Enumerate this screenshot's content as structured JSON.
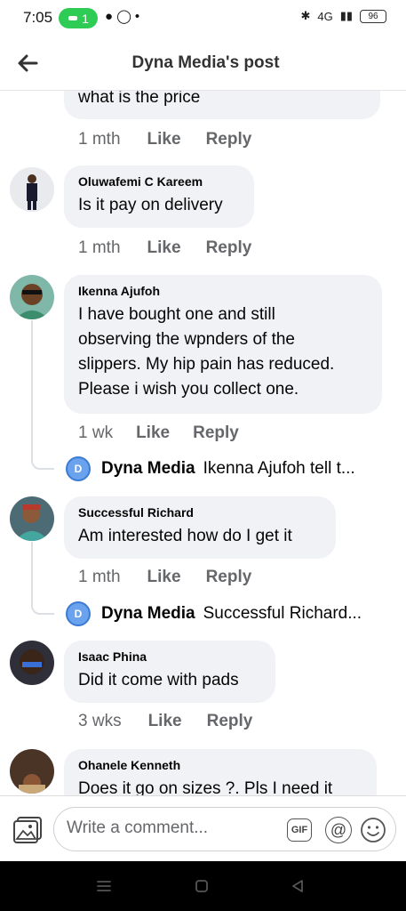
{
  "status_bar": {
    "time": "7:05",
    "sim_badge": "1",
    "network": "4G",
    "battery": "96"
  },
  "header": {
    "title": "Dyna Media's post"
  },
  "comments": [
    {
      "text": "what is the price",
      "time": "1 mth",
      "like": "Like",
      "reply": "Reply"
    },
    {
      "author": "Oluwafemi C Kareem",
      "text": "Is it pay on delivery",
      "time": "1 mth",
      "like": "Like",
      "reply": "Reply"
    },
    {
      "author": "Ikenna Ajufoh",
      "text_lines": [
        "I have bought one and still",
        "observing the wpnders of the",
        "slippers. My hip pain has reduced.",
        "Please i wish you collect one."
      ],
      "time": "1 wk",
      "like": "Like",
      "reply": "Reply",
      "reply_preview": {
        "initial": "D",
        "name": "Dyna Media",
        "text": "Ikenna Ajufoh tell t..."
      }
    },
    {
      "author": "Successful Richard",
      "text": "Am interested how do I get it",
      "time": "1 mth",
      "like": "Like",
      "reply": "Reply",
      "reply_preview": {
        "initial": "D",
        "name": "Dyna Media",
        "text": "Successful Richard..."
      }
    },
    {
      "author": "Isaac Phina",
      "text": "Did it come with pads",
      "time": "3 wks",
      "like": "Like",
      "reply": "Reply"
    },
    {
      "author": "Ohanele Kenneth",
      "text": "Does it go on sizes ?. Pls I need it"
    }
  ],
  "composer": {
    "placeholder": "Write a comment...",
    "gif_label": "GIF",
    "at_label": "@"
  },
  "colors": {
    "bubble": "#f0f2f5",
    "meta_text": "#65676b",
    "status_pill": "#2ecc55"
  }
}
